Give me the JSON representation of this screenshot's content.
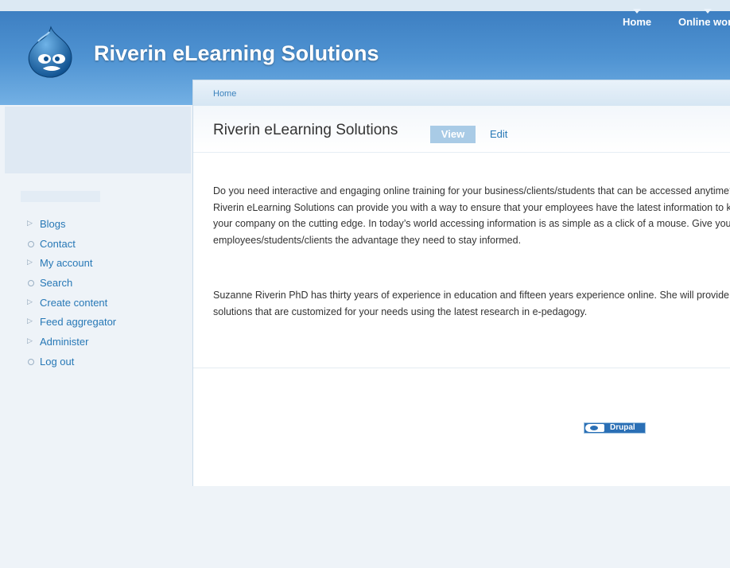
{
  "site": {
    "name": "Riverin eLearning Solutions"
  },
  "primary_links": [
    {
      "label": "Home"
    },
    {
      "label": "Online work"
    }
  ],
  "breadcrumb": {
    "home": "Home"
  },
  "page": {
    "title": "Riverin eLearning Solutions",
    "tabs": {
      "view": "View",
      "edit": "Edit"
    },
    "paragraphs": [
      "Do you need interactive and engaging online training for your business/clients/students that can be accessed anytime? Riverin eLearning Solutions can provide you with a way to ensure that your employees have the latest information to keep your company on the cutting edge. In today’s world accessing information is as simple as a click of a mouse. Give your employees/students/clients the advantage they need to stay informed.",
      "Suzanne Riverin PhD has thirty years of experience in education and fifteen years experience online. She will provide solutions that are customized for your needs using the latest research in e-pedagogy."
    ]
  },
  "sidebar": {
    "items": [
      {
        "label": "Blogs",
        "bullet": "triangle"
      },
      {
        "label": "Contact",
        "bullet": "circle"
      },
      {
        "label": "My account",
        "bullet": "triangle"
      },
      {
        "label": "Search",
        "bullet": "circle"
      },
      {
        "label": "Create content",
        "bullet": "triangle"
      },
      {
        "label": "Feed aggregator",
        "bullet": "triangle"
      },
      {
        "label": "Administer",
        "bullet": "triangle"
      },
      {
        "label": "Log out",
        "bullet": "circle"
      }
    ]
  },
  "footer": {
    "badge_label": "Drupal"
  },
  "colors": {
    "link": "#2778b6",
    "header_top": "#3d7fc2",
    "header_bottom": "#73b0e4",
    "tab_active": "#a9cbe6"
  },
  "icons": {
    "logo": "drupal-drop-logo-icon",
    "badge": "drupal-badge-icon"
  }
}
